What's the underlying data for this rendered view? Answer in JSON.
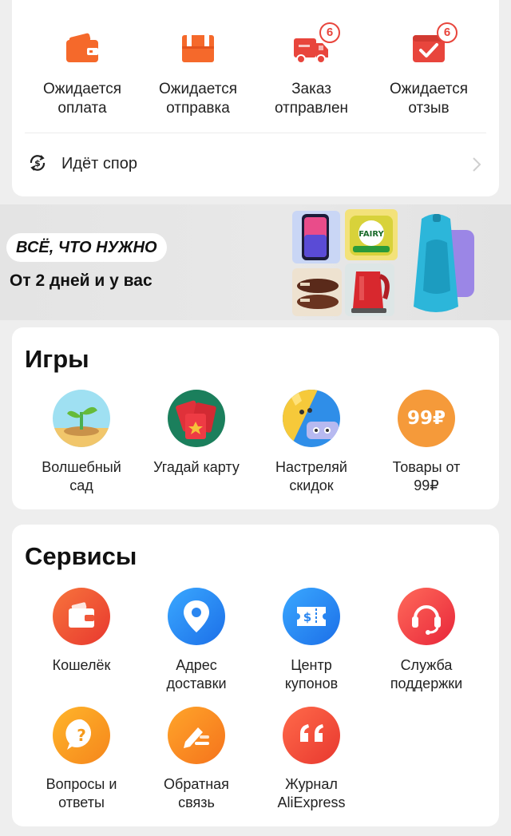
{
  "colors": {
    "accent": "#e8453c",
    "orange": "#f5692b",
    "blue": "#1e90ff",
    "background": "#eeeeee"
  },
  "orders": {
    "items": [
      {
        "label": "Ожидается\nоплата",
        "icon": "wallet-icon",
        "badge": ""
      },
      {
        "label": "Ожидается\nотправка",
        "icon": "package-icon",
        "badge": ""
      },
      {
        "label": "Заказ\nотправлен",
        "icon": "truck-icon",
        "badge": "6"
      },
      {
        "label": "Ожидается\nотзыв",
        "icon": "review-icon",
        "badge": "6"
      }
    ],
    "dispute_label": "Идёт спор"
  },
  "banner": {
    "headline": "ВСЁ, ЧТО НУЖНО",
    "subtitle": "От 2 дней и у вас"
  },
  "games": {
    "title": "Игры",
    "items": [
      {
        "label": "Волшебный\nсад",
        "icon": "sprout-icon"
      },
      {
        "label": "Угадай карту",
        "icon": "cards-icon"
      },
      {
        "label": "Настреляй\nскидок",
        "icon": "shooter-icon"
      },
      {
        "label": "Товары от\n99₽",
        "icon": "price-99-icon",
        "icon_text": "99₽"
      }
    ]
  },
  "services": {
    "title": "Сервисы",
    "items": [
      {
        "label": "Кошелёк",
        "icon": "wallet-icon"
      },
      {
        "label": "Адрес\nдоставки",
        "icon": "location-pin-icon"
      },
      {
        "label": "Центр\nкупонов",
        "icon": "coupon-icon"
      },
      {
        "label": "Служба\nподдержки",
        "icon": "headset-icon"
      },
      {
        "label": "Вопросы и\nответы",
        "icon": "question-icon"
      },
      {
        "label": "Обратная\nсвязь",
        "icon": "feedback-icon"
      },
      {
        "label": "Журнал\nAliExpress",
        "icon": "quote-icon"
      }
    ]
  }
}
